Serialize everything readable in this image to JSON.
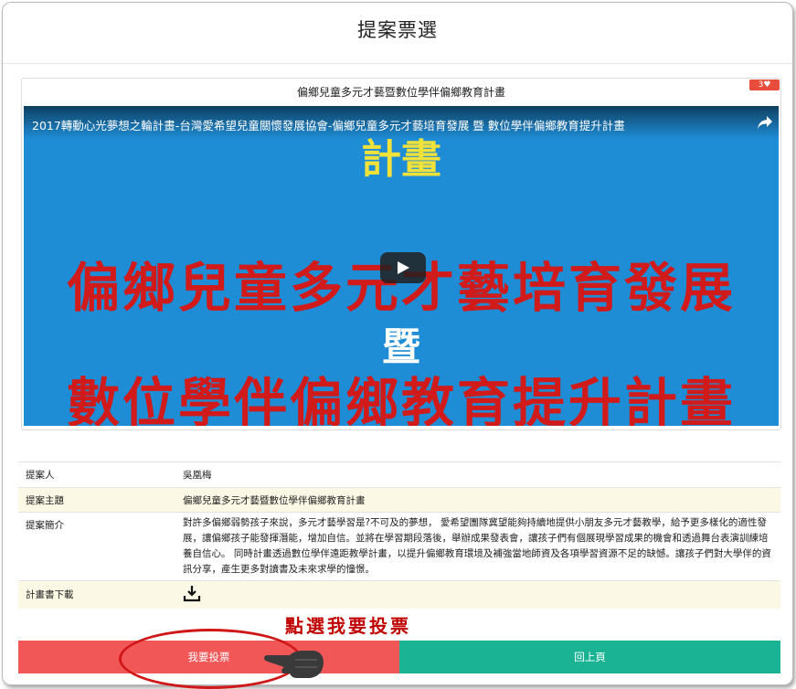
{
  "page": {
    "title": "提案票選"
  },
  "proposal": {
    "card_title": "偏鄉兒童多元才藝暨數位學伴偏鄉教育計畫",
    "vote_badge": "3♥",
    "video": {
      "title": "2017轉動心光夢想之輪計畫-台灣愛希望兒童關懷發展協會-偏鄉兒童多元才藝培育發展 暨 數位學伴偏鄉教育提升計畫",
      "poster_lines": [
        "計畫",
        "偏鄉兒童多元才藝培育發展",
        "暨",
        "數位學伴偏鄉教育提升計畫"
      ]
    }
  },
  "details": {
    "rows": [
      {
        "label": "提案人",
        "value": "吳凰梅"
      },
      {
        "label": "提案主題",
        "value": "偏鄉兒童多元才藝暨數位學伴偏鄉教育計畫"
      },
      {
        "label": "提案簡介",
        "value": "對許多偏鄉弱勢孩子來說，多元才藝學習是?不可及的夢想， 愛希望團隊冀望能夠持續地提供小朋友多元才藝教學，給予更多樣化的適性發展，讓偏鄉孩子能發揮潛能，增加自信。並將在學習期段落後，舉辦成果發表會，讓孩子們有個展現學習成果的機會和透過舞台表演訓練培養自信心。 同時計畫透過數位學伴遠距教學計畫，以提升偏鄉教育環境及補強當地師資及各項學習資源不足的缺憾。讓孩子們對大學伴的資訊分享，產生更多對讀書及未來求學的憧憬。"
      },
      {
        "label": "計畫書下載",
        "value": ""
      }
    ]
  },
  "annotation": "點選我要投票",
  "buttons": {
    "vote": "我要投票",
    "back": "回上頁"
  },
  "colors": {
    "vote": "#f25757",
    "back": "#1ab394",
    "annotation": "#c00000"
  },
  "icons": {
    "play": "play-icon",
    "share": "share-icon",
    "download": "download-icon",
    "hand": "pointing-hand-icon"
  }
}
